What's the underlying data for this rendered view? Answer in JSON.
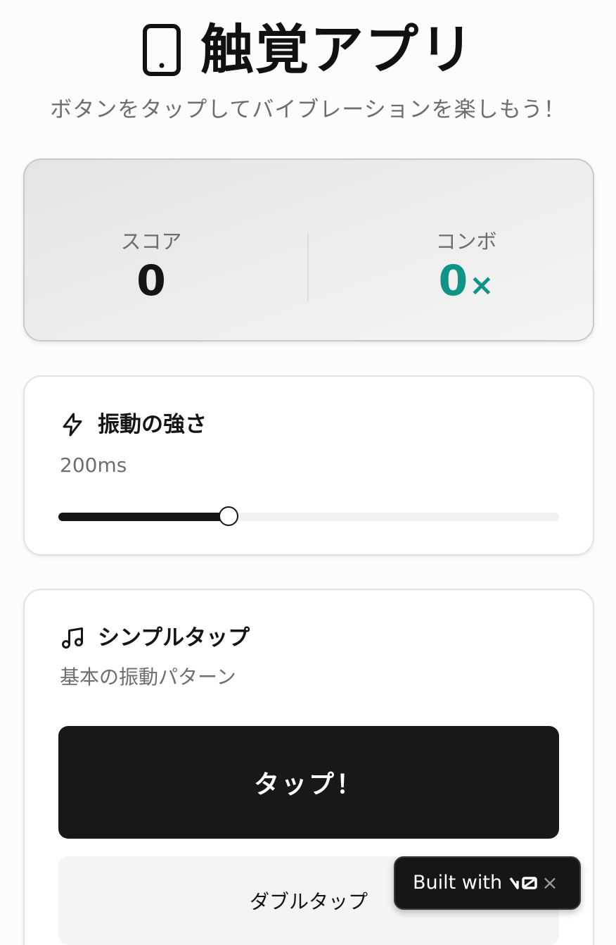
{
  "app": {
    "title": "触覚アプリ",
    "subtitle": "ボタンをタップしてバイブレーションを楽しもう！",
    "icon": "smartphone-icon"
  },
  "stats": {
    "score_label": "スコア",
    "score_value": "0",
    "combo_label": "コンボ",
    "combo_value": "0",
    "combo_suffix": "×",
    "combo_color": "#0f9488"
  },
  "intensity": {
    "icon": "lightning-icon",
    "title": "振動の強さ",
    "value_text": "200ms",
    "slider_fraction": 0.34
  },
  "pattern": {
    "icon": "music-note-icon",
    "title": "シンプルタップ",
    "description": "基本の振動パターン",
    "tap_label": "タップ！",
    "double_label": "ダブルタップ"
  },
  "badge": {
    "text": "Built with",
    "logo": "v0",
    "close_icon": "close-icon"
  }
}
